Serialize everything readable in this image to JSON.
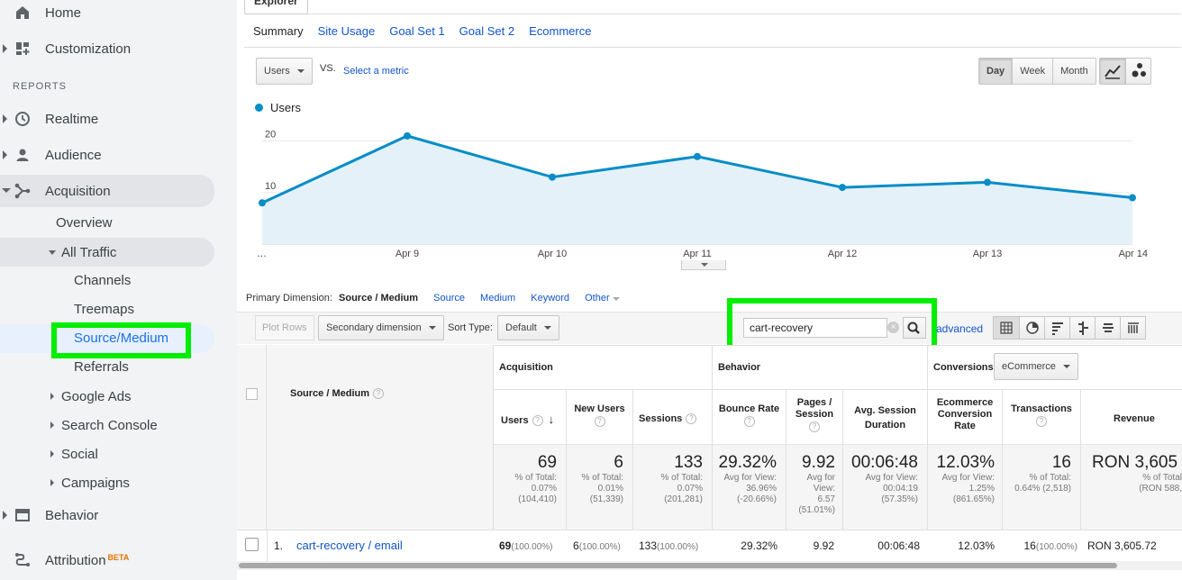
{
  "sidebar": {
    "home": "Home",
    "customization": "Customization",
    "reports_heading": "REPORTS",
    "realtime": "Realtime",
    "audience": "Audience",
    "acquisition": "Acquisition",
    "overview": "Overview",
    "all_traffic": "All Traffic",
    "channels": "Channels",
    "treemaps": "Treemaps",
    "source_medium": "Source/Medium",
    "referrals": "Referrals",
    "google_ads": "Google Ads",
    "search_console": "Search Console",
    "social": "Social",
    "campaigns": "Campaigns",
    "behavior": "Behavior",
    "attribution": "Attribution",
    "beta": "BETA"
  },
  "explorer": {
    "tab": "Explorer",
    "subtabs": [
      "Summary",
      "Site Usage",
      "Goal Set 1",
      "Goal Set 2",
      "Ecommerce"
    ]
  },
  "chart_controls": {
    "metric": "Users",
    "vs": "VS.",
    "select_metric": "Select a metric",
    "periods": [
      "Day",
      "Week",
      "Month"
    ],
    "active_period": "Day"
  },
  "chart_data": {
    "type": "area",
    "series": [
      {
        "name": "Users",
        "values": [
          8,
          21,
          13,
          17,
          11,
          12,
          9
        ]
      }
    ],
    "x": [
      "…",
      "Apr 9",
      "Apr 10",
      "Apr 11",
      "Apr 12",
      "Apr 13",
      "Apr 14"
    ],
    "yticks": [
      10,
      20
    ],
    "ylim": [
      0,
      25
    ],
    "color": "#058dc7",
    "fill": "#e4f1f9",
    "grid": true,
    "legend": "top-left"
  },
  "table_controls": {
    "primary_dimension_label": "Primary Dimension:",
    "primary_dimension": "Source / Medium",
    "dimension_links": [
      "Source",
      "Medium",
      "Keyword"
    ],
    "other": "Other",
    "plot_rows": "Plot Rows",
    "secondary_dimension": "Secondary dimension",
    "sort_type_label": "Sort Type:",
    "sort_type": "Default",
    "search_value": "cart-recovery",
    "advanced": "advanced"
  },
  "table": {
    "dimension_header": "Source / Medium",
    "groups": {
      "acquisition": "Acquisition",
      "behavior": "Behavior",
      "conversions": "Conversions",
      "conversions_select": "eCommerce"
    },
    "columns": {
      "users": "Users",
      "new_users": "New Users",
      "sessions": "Sessions",
      "bounce_rate": "Bounce Rate",
      "pages_session": "Pages / Session",
      "avg_session": "Avg. Session Duration",
      "ecom_rate": "Ecommerce Conversion Rate",
      "transactions": "Transactions",
      "revenue": "Revenue"
    },
    "totals": {
      "users": "69",
      "users_sub": "% of Total: 0.07% (104,410)",
      "new_users": "6",
      "new_users_sub": "% of Total: 0.01% (51,339)",
      "sessions": "133",
      "sessions_sub": "% of Total: 0.07% (201,281)",
      "bounce_rate": "29.32%",
      "bounce_rate_sub": "Avg for View: 36.96% (-20.66%)",
      "pages_session": "9.92",
      "pages_session_sub": "Avg for View: 6.57 (51.01%)",
      "avg_session": "00:06:48",
      "avg_session_sub": "Avg for View: 00:04:19 (57.35%)",
      "ecom_rate": "12.03%",
      "ecom_rate_sub": "Avg for View: 1.25% (861.65%)",
      "transactions": "16",
      "transactions_sub": "% of Total: 0.64% (2,518)",
      "revenue": "RON 3,605",
      "revenue_sub": "% of Total (RON 588,"
    },
    "rows": [
      {
        "index": "1.",
        "source_medium": "cart-recovery / email",
        "users": "69",
        "users_pct": "(100.00%)",
        "new_users": "6",
        "new_users_pct": "(100.00%)",
        "sessions": "133",
        "sessions_pct": "(100.00%)",
        "bounce_rate": "29.32%",
        "pages_session": "9.92",
        "avg_session": "00:06:48",
        "ecom_rate": "12.03%",
        "transactions": "16",
        "transactions_pct": "(100.00%)",
        "revenue": "RON 3,605.72"
      }
    ]
  }
}
